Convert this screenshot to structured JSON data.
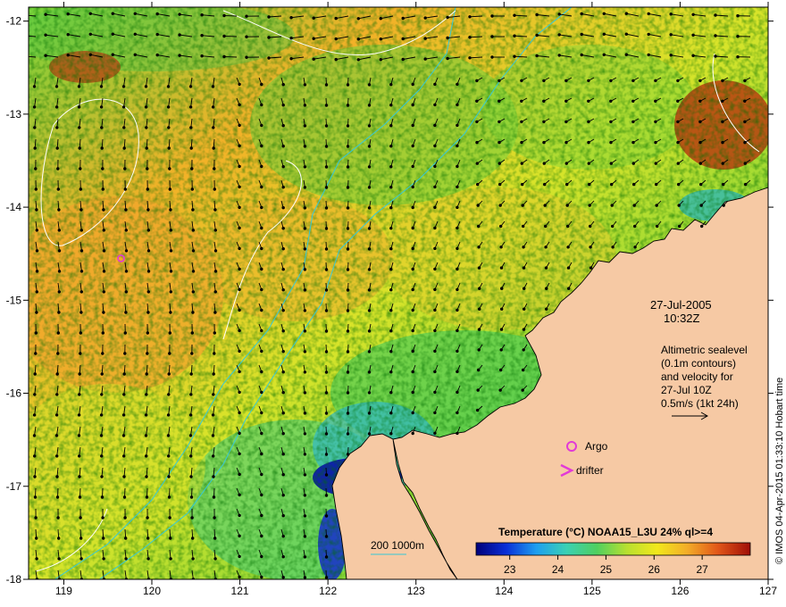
{
  "map": {
    "date": "27-Jul-2005",
    "time": "10:32Z",
    "altimetry_lines": [
      "Altimetric sealevel",
      "(0.1m contours)",
      "and velocity for",
      "27-Jul 10Z",
      "0.5m/s (1kt 24h)"
    ],
    "legend_argo": "Argo",
    "legend_drifter": "drifter",
    "depth_legend": "200  1000m",
    "credit": "© IMOS 04-Apr-2015 01:33:10 Hobart time",
    "lon_ticks": [
      "119",
      "120",
      "121",
      "122",
      "123",
      "124",
      "125",
      "126",
      "127"
    ],
    "lat_ticks": [
      "-12",
      "-13",
      "-14",
      "-15",
      "-16",
      "-17",
      "-18"
    ],
    "lon_range": [
      118.6,
      127
    ],
    "lat_range": [
      -18,
      -11.85
    ],
    "argo_float": {
      "lon": 119.65,
      "lat": -14.55
    },
    "colors": {
      "land": "#f6c9a4",
      "coast": "#000000",
      "isobath": "#36c8d6",
      "sealevel_contour": "#ffffff",
      "marker": "#e23ad7",
      "vector": "#000000"
    }
  },
  "colorbar": {
    "title": "Temperature (°C) NOAA15_L3U 24% ql>=4",
    "ticks": [
      "23",
      "24",
      "25",
      "26",
      "27"
    ],
    "range": [
      22.3,
      28.0
    ],
    "colors": [
      "#00007a",
      "#0a2fd8",
      "#1e9ff0",
      "#3ad1b4",
      "#4fd060",
      "#b8e030",
      "#f2e81c",
      "#f3ad28",
      "#e2581a",
      "#a00e07"
    ]
  }
}
